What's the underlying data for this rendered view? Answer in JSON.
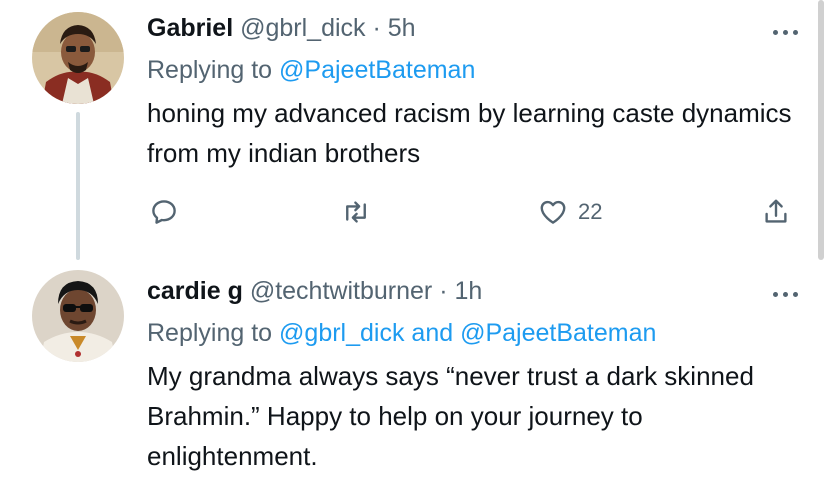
{
  "tweets": [
    {
      "author_name": "Gabriel",
      "handle": "@gbrl_dick",
      "separator": "·",
      "time": "5h",
      "replying_prefix": "Replying to",
      "replying_to_1": "@PajeetBateman",
      "text": "honing my advanced racism by learning caste dynamics from my indian brothers",
      "like_count": "22",
      "avatar_icon": "avatar-gabriel-icon"
    },
    {
      "author_name": "cardie g",
      "handle": "@techtwitburner",
      "separator": "·",
      "time": "1h",
      "replying_prefix": "Replying to",
      "replying_to_1": "@gbrl_dick",
      "replying_and": "and",
      "replying_to_2": "@PajeetBateman",
      "text": "My grandma always says “never trust a dark skinned Brahmin.” Happy to help on your journey to enlightenment.",
      "avatar_icon": "avatar-cardie-icon"
    }
  ],
  "colors": {
    "text": "#0f1419",
    "secondary": "#536471",
    "link": "#1d9bf0",
    "thread_line": "#cfd9de"
  },
  "icons": [
    "reply-icon",
    "retweet-icon",
    "like-icon",
    "share-icon",
    "more-icon"
  ]
}
